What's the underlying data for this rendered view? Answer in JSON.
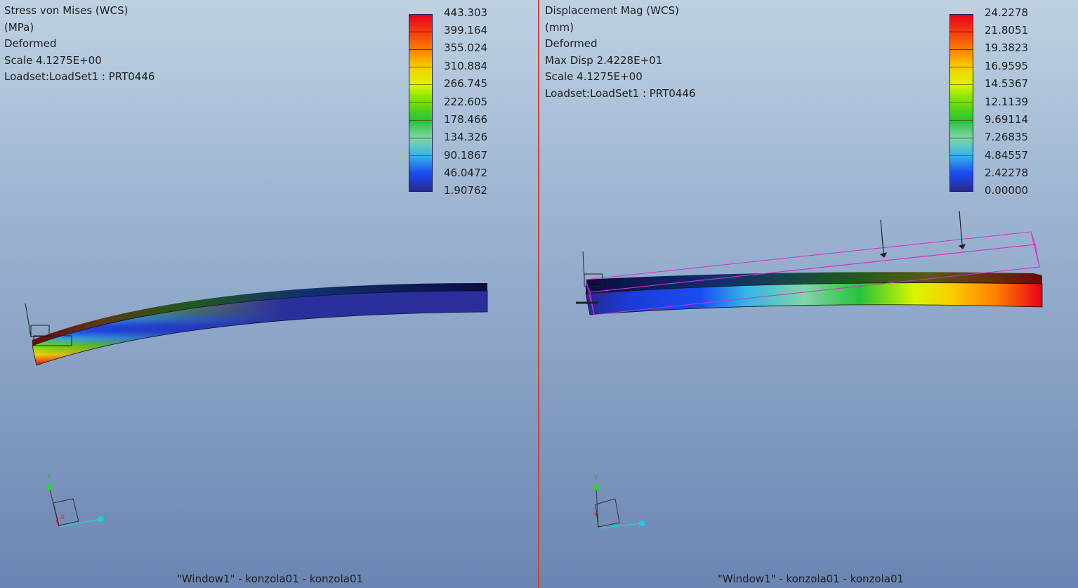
{
  "left_view": {
    "info_lines": [
      "Stress von Mises (WCS)",
      "(MPa)",
      "Deformed",
      "Scale  4.1275E+00",
      "Loadset:LoadSet1 :  PRT0446"
    ],
    "legend": {
      "values": [
        "443.303",
        "399.164",
        "355.024",
        "310.884",
        "266.745",
        "222.605",
        "178.466",
        "134.326",
        "90.1867",
        "46.0472",
        "1.90762"
      ],
      "band_colors": [
        "#e8001a",
        "#f23d10",
        "#ff7e00",
        "#f7cf00",
        "#d9f500",
        "#6fe000",
        "#27c23c",
        "#82d6a6",
        "#35b4e6",
        "#1a4cf2",
        "#27288f"
      ]
    },
    "triad": {
      "x_label": "X",
      "y_label": "Y",
      "z_label": "Z"
    },
    "footer": "\"Window1\" - konzola01 - konzola01"
  },
  "right_view": {
    "info_lines": [
      "Displacement Mag (WCS)",
      "(mm)",
      "Deformed",
      "Max Disp  2.4228E+01",
      "Scale  4.1275E+00",
      "Loadset:LoadSet1 :  PRT0446"
    ],
    "legend": {
      "values": [
        "24.2278",
        "21.8051",
        "19.3823",
        "16.9595",
        "14.5367",
        "12.1139",
        "9.69114",
        "7.26835",
        "4.84557",
        "2.42278",
        "0.00000"
      ],
      "band_colors": [
        "#e8001a",
        "#f23d10",
        "#ff7e00",
        "#f7cf00",
        "#d9f500",
        "#6fe000",
        "#27c23c",
        "#82d6a6",
        "#35b4e6",
        "#1a4cf2",
        "#27288f"
      ]
    },
    "triad": {
      "y_label": "Y",
      "z_label": "Z"
    },
    "footer": "\"Window1\" - konzola01 - konzola01"
  }
}
